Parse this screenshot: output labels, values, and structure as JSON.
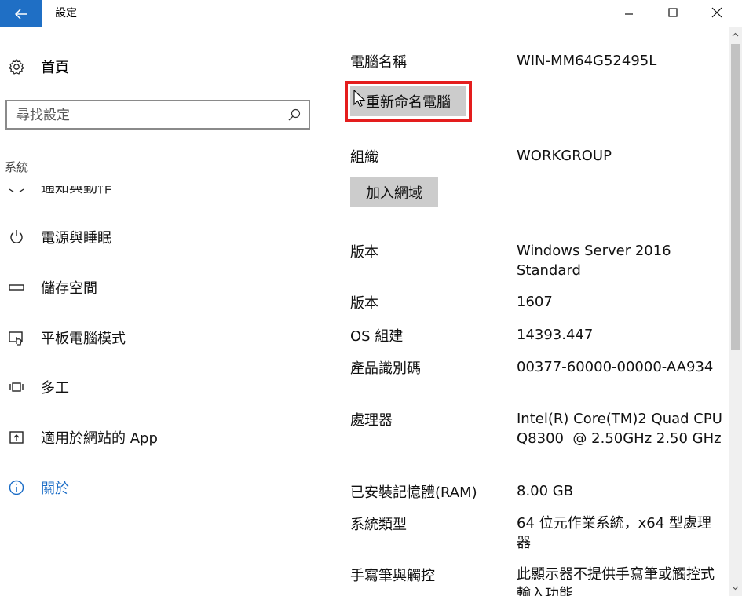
{
  "window": {
    "title": "設定",
    "accent_color": "#1f6fc5",
    "highlight_color": "#e41d1d"
  },
  "sidebar": {
    "home_label": "首頁",
    "search_placeholder": "尋找設定",
    "section_heading": "系統",
    "partial_item_label": "通知與動作",
    "items": [
      {
        "label": "電源與睡眠",
        "icon": "power-icon"
      },
      {
        "label": "儲存空間",
        "icon": "storage-icon"
      },
      {
        "label": "平板電腦模式",
        "icon": "tablet-mode-icon"
      },
      {
        "label": "多工",
        "icon": "multitasking-icon"
      },
      {
        "label": "適用於網站的 App",
        "icon": "apps-for-websites-icon"
      },
      {
        "label": "關於",
        "icon": "info-icon",
        "active": true
      }
    ]
  },
  "about": {
    "pc_name": {
      "label": "電腦名稱",
      "value": "WIN-MM64G52495L"
    },
    "rename_button": "重新命名電腦",
    "organization": {
      "label": "組織",
      "value": "WORKGROUP"
    },
    "join_domain_button": "加入網域",
    "specs": [
      {
        "label": "版本",
        "value": "Windows Server 2016 Standard"
      },
      {
        "label": "版本",
        "value": "1607"
      },
      {
        "label": "OS 組建",
        "value": "14393.447"
      },
      {
        "label": "產品識別碼",
        "value": "00377-60000-00000-AA934"
      },
      {
        "label": "處理器",
        "value": "Intel(R) Core(TM)2 Quad CPU    Q8300  @ 2.50GHz 2.50 GHz"
      },
      {
        "label": "已安裝記憶體(RAM)",
        "value": "8.00 GB"
      },
      {
        "label": "系統類型",
        "value": "64 位元作業系統，x64 型處理器"
      },
      {
        "label": "手寫筆與觸控",
        "value": "此顯示器不提供手寫筆或觸控式輸入功能"
      }
    ]
  }
}
